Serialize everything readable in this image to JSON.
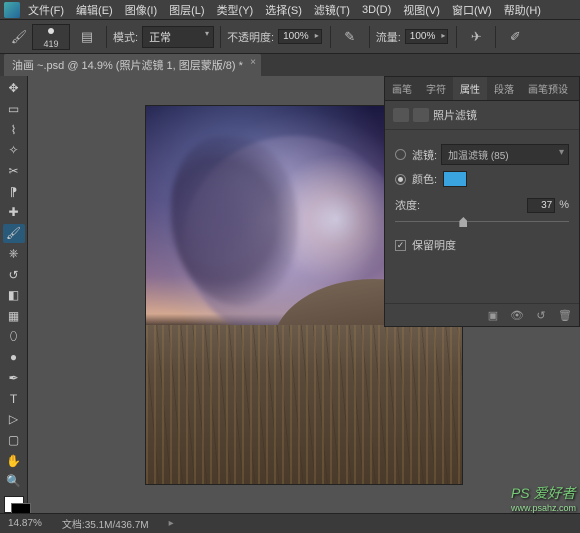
{
  "menu": {
    "items": [
      "文件(F)",
      "编辑(E)",
      "图像(I)",
      "图层(L)",
      "类型(Y)",
      "选择(S)",
      "滤镜(T)",
      "3D(D)",
      "视图(V)",
      "窗口(W)",
      "帮助(H)"
    ]
  },
  "options": {
    "brush_size": "419",
    "mode_label": "模式:",
    "mode_value": "正常",
    "opacity_label": "不透明度:",
    "opacity_value": "100%",
    "flow_label": "流量:",
    "flow_value": "100%"
  },
  "tab": {
    "title": "油画 ~.psd @ 14.9% (照片滤镜 1, 图层蒙版/8) *"
  },
  "panel": {
    "tabs": [
      "画笔",
      "字符",
      "属性",
      "段落",
      "画笔预设"
    ],
    "active_tab": 2,
    "title": "照片滤镜",
    "filter_label": "滤镜:",
    "filter_value": "加温滤镜 (85)",
    "color_label": "颜色:",
    "color_value": "#3aa4e0",
    "density_label": "浓度:",
    "density_value": "37",
    "density_unit": "%",
    "preserve_label": "保留明度"
  },
  "status": {
    "zoom": "14.87%",
    "doc": "文档:35.1M/436.7M"
  },
  "watermark": {
    "title": "PS 爱好者",
    "url": "www.psahz.com"
  }
}
